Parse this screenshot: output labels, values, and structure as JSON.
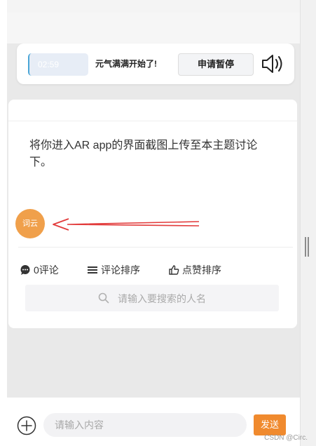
{
  "status_bar": {
    "timer": "02:59",
    "status_text": "元气满满开始了!",
    "pause_button": "申请暂停",
    "speaker_icon": "speaker-icon"
  },
  "topic": {
    "text": "将你进入AR app的界面截图上传至本主题讨论下。",
    "avatar_label": "词云",
    "annotation_arrow_color": "#e23b3b"
  },
  "actions": {
    "comments": "0评论",
    "comment_sort": "评论排序",
    "like_sort": "点赞排序"
  },
  "search": {
    "placeholder": "请输入要搜索的人名"
  },
  "bottom_bar": {
    "input_placeholder": "请输入内容",
    "send_label": "发送"
  },
  "watermark": "CSDN @Circ.",
  "colors": {
    "accent_orange": "#f08a2e",
    "avatar_orange": "#f0a04b",
    "background": "#e9e9e9"
  }
}
